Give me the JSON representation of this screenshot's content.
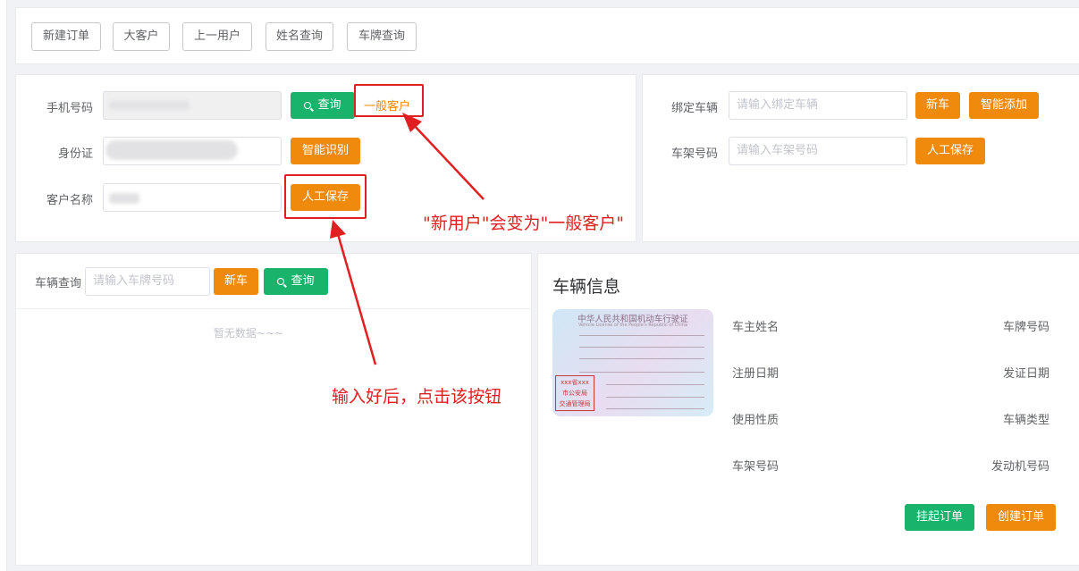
{
  "toolbar": {
    "new_order": "新建订单",
    "big_customer": "大客户",
    "prev_user": "上一用户",
    "name_query": "姓名查询",
    "plate_query": "车牌查询"
  },
  "customer": {
    "phone_label": "手机号码",
    "query_button": "查询",
    "customer_type": "一般客户",
    "id_label": "身份证",
    "smart_recognize_button": "智能识别",
    "name_label": "客户名称",
    "manual_save_button": "人工保存"
  },
  "vehicle_bind": {
    "bind_label": "绑定车辆",
    "bind_placeholder": "请输入绑定车辆",
    "new_car_button": "新车",
    "smart_add_button": "智能添加",
    "frame_label": "车架号码",
    "frame_placeholder": "请输入车架号码",
    "manual_save_button": "人工保存"
  },
  "vehicle_search": {
    "label": "车辆查询",
    "placeholder": "请输入车牌号码",
    "new_car_button": "新车",
    "query_button": "查询",
    "empty_text": "暂无数据~~~"
  },
  "vehicle_info": {
    "title": "车辆信息",
    "fields_left": [
      "车主姓名",
      "注册日期",
      "使用性质",
      "车架号码"
    ],
    "fields_right": [
      "车牌号码",
      "发证日期",
      "车辆类型",
      "发动机号码"
    ],
    "hang_order_button": "挂起订单",
    "create_order_button": "创建订单",
    "license_card": {
      "title_cn": "中华人民共和国机动车行驶证",
      "title_en": "Vehicle License of the People's Republic of China",
      "seal_lines": [
        "xxx省xxx",
        "市公安局",
        "交通管理局"
      ]
    }
  },
  "annotations": {
    "type_change_note": "\"新用户\"会变为\"一般客户\"",
    "click_note": "输入好后，点击该按钮"
  },
  "colors": {
    "orange": "#f08a0c",
    "green": "#19b36b",
    "annotation_red": "#e02020"
  }
}
